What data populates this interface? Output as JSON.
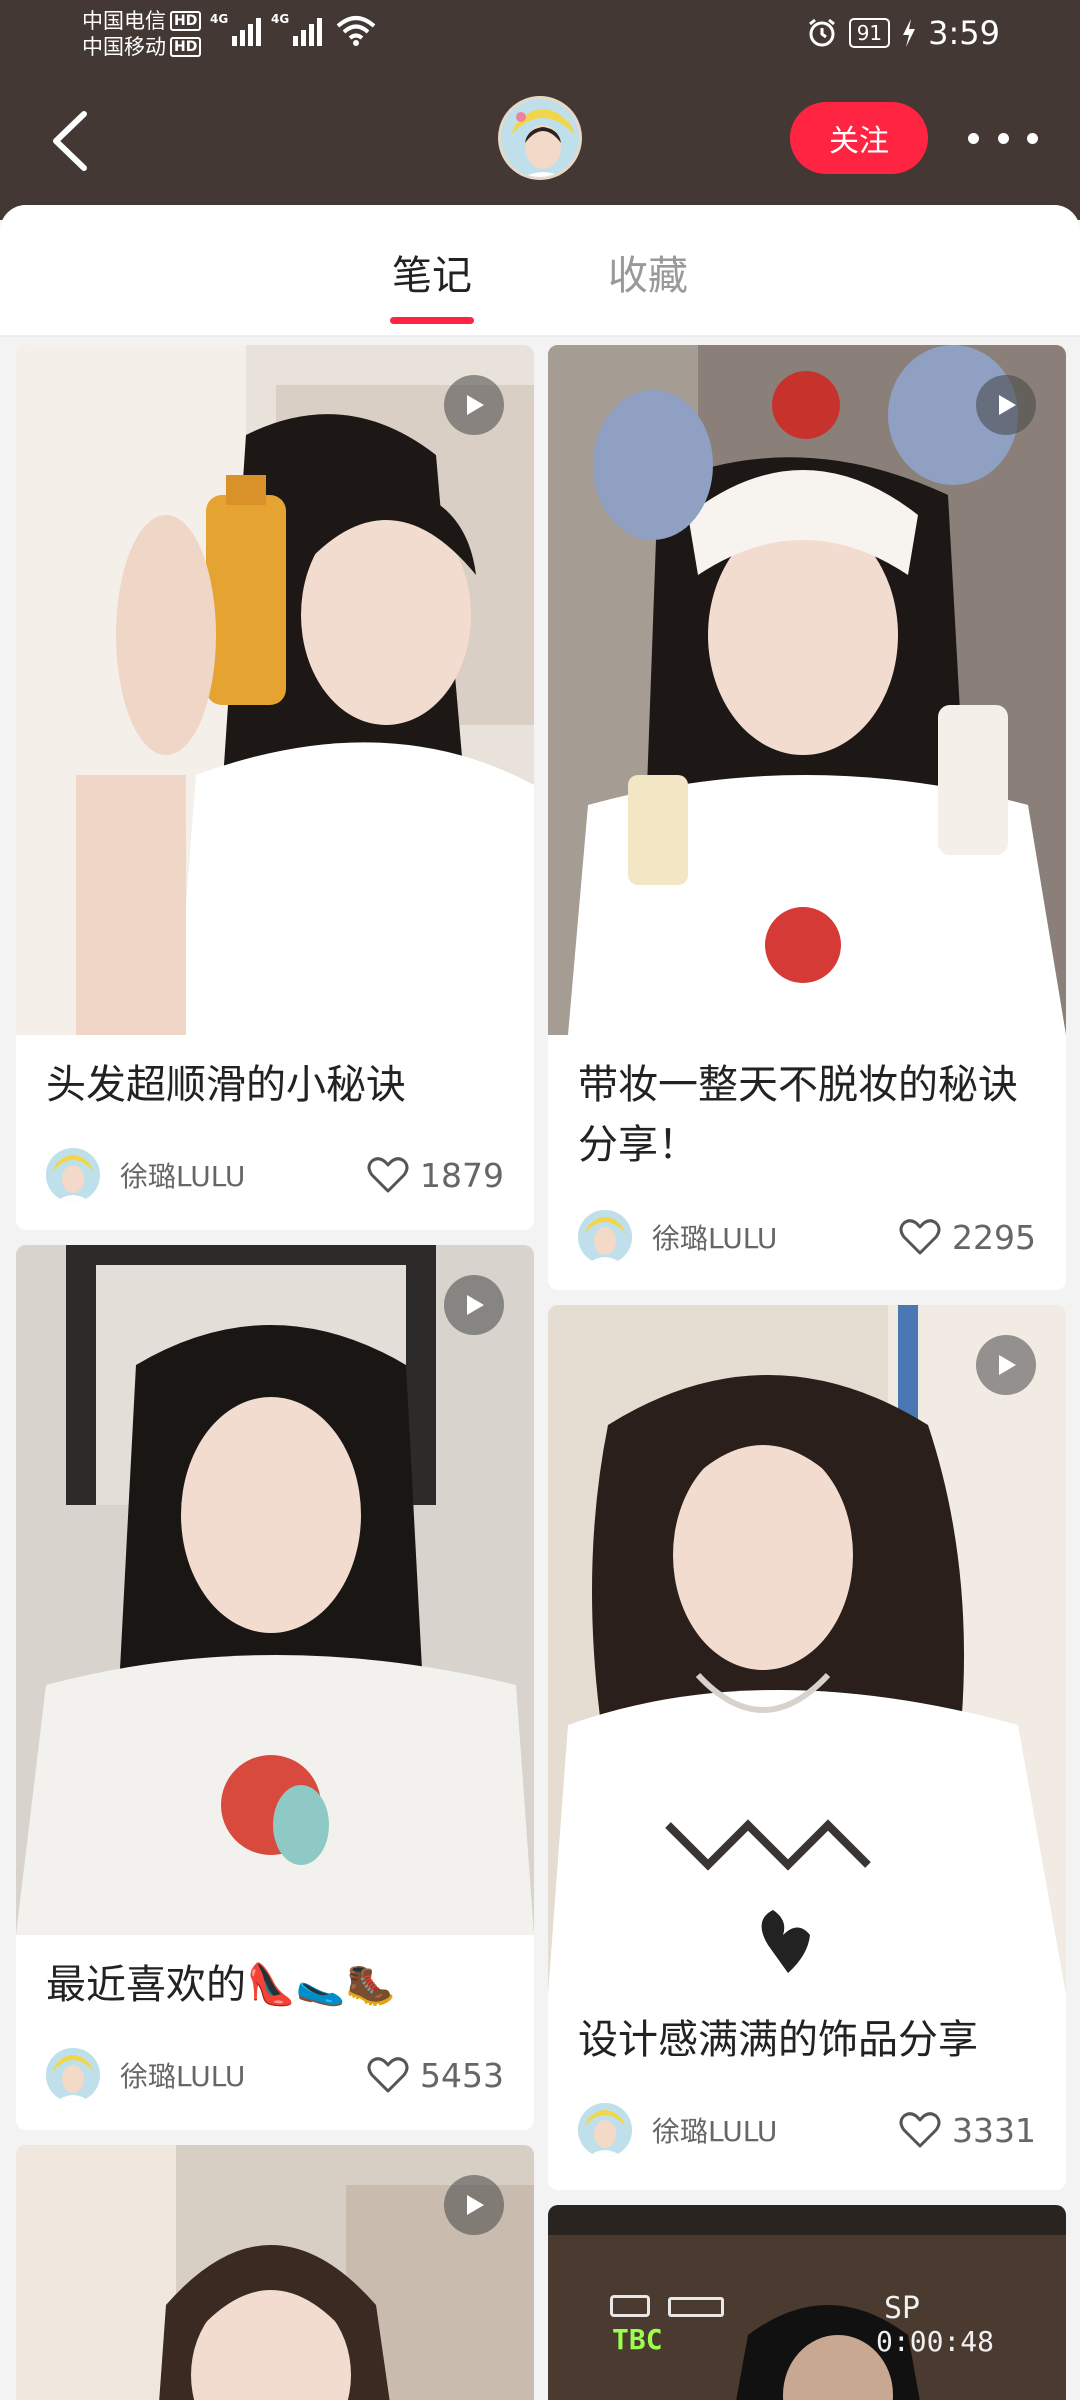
{
  "status_bar": {
    "carrier1": "中国电信",
    "carrier2": "中国移动",
    "hd_label": "HD",
    "net1": "4G",
    "net2": "4G",
    "battery": "91",
    "time": "3:59"
  },
  "header": {
    "follow_label": "关注"
  },
  "tabs": [
    {
      "label": "笔记"
    },
    {
      "label": "收藏"
    }
  ],
  "notes": [
    {
      "title": "头发超顺滑的小秘诀",
      "author": "徐璐LULU",
      "likes": "1879"
    },
    {
      "title": "带妆一整天不脱妆的秘诀分享！",
      "author": "徐璐LULU",
      "likes": "2295"
    },
    {
      "title": "最近喜欢的👠🥿🥾",
      "author": "徐璐LULU",
      "likes": "5453"
    },
    {
      "title": "设计感满满的饰品分享",
      "author": "徐璐LULU",
      "likes": "3331"
    }
  ],
  "video_overlay": {
    "tape_label": "TBC",
    "sp_label": "SP",
    "timecode": "0:00:48"
  },
  "colors": {
    "accent": "#ff2442",
    "header_bg": "#433834"
  }
}
